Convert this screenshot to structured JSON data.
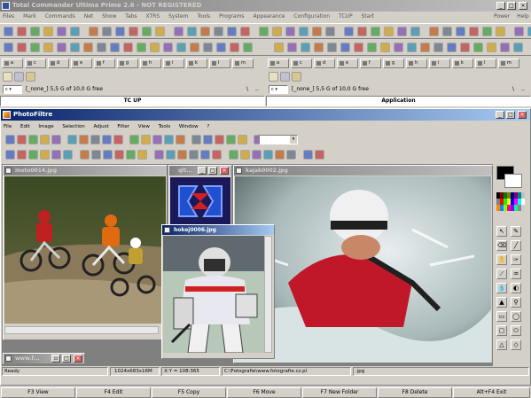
{
  "tc": {
    "title": "Total Commander Ultima Prime 2.6 - NOT REGISTERED",
    "menu": [
      "Files",
      "Mark",
      "Commands",
      "Net",
      "Show",
      "Tabs",
      "XTRS",
      "System",
      "Tools",
      "Programs",
      "Appearance",
      "Configuration",
      "TCUP",
      "Start"
    ],
    "menu_right": [
      "Power",
      "Help"
    ],
    "left_path": "[_none_]  5,5 G of 10,0 G free",
    "right_path": "[_none_]  5,5 G of 10,0 G free",
    "left_drive": "c",
    "right_drive": "c",
    "left_tab": "TC UP",
    "right_tab": "Application",
    "drives": [
      "a",
      "c",
      "d",
      "e",
      "f",
      "g",
      "h",
      "i",
      "k",
      "l",
      "m"
    ],
    "fkeys": [
      "F3 View",
      "F4 Edit",
      "F5 Copy",
      "F6 Move",
      "F7 New Folder",
      "F8 Delete",
      "Alt+F4 Exit"
    ]
  },
  "pf": {
    "title": "PhotoFiltre",
    "menu": [
      "File",
      "Edit",
      "Image",
      "Selection",
      "Adjust",
      "Filter",
      "View",
      "Tools",
      "Window",
      "?"
    ],
    "zoom_value": "",
    "windows": {
      "moto": "moto0014.jpg",
      "qlt": "qlt...",
      "hokej": "hokej0006.jpg",
      "kajak": "kajak0002.jpg",
      "www": "www.f..."
    },
    "status": {
      "state": "Ready",
      "size": "1024x683x16M",
      "coords": "X:Y = 108:365",
      "path": "C:\\Fotografie\\www.fotografie.cz.pl",
      "ext": ".jpg"
    }
  }
}
